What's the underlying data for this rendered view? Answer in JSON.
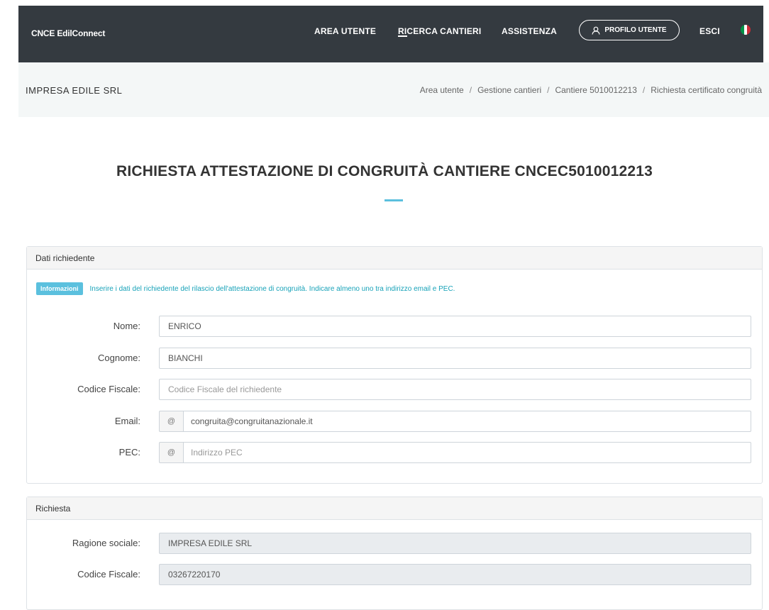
{
  "header": {
    "brand": "CNCE EdilConnect",
    "nav": [
      {
        "label": "AREA UTENTE",
        "active": false
      },
      {
        "label": "RICERCA CANTIERI",
        "active": true
      },
      {
        "label": "ASSISTENZA",
        "active": false
      }
    ],
    "profile_label": "PROFILO UTENTE",
    "logout_label": "ESCI",
    "flag_colors": [
      "#009246",
      "#ffffff",
      "#ce2b37"
    ]
  },
  "subheader": {
    "company": "IMPRESA EDILE SRL",
    "breadcrumb": [
      "Area utente",
      "Gestione cantieri",
      "Cantiere 5010012213",
      "Richiesta certificato congruità"
    ]
  },
  "page": {
    "title": "RICHIESTA ATTESTAZIONE DI CONGRUITÀ CANTIERE CNCEC5010012213"
  },
  "requester_panel": {
    "heading": "Dati richiedente",
    "info_badge": "Informazioni",
    "info_text": "Inserire i dati del richiedente del rilascio dell'attestazione di congruità. Indicare almeno uno tra indirizzo email e PEC.",
    "fields": {
      "nome": {
        "label": "Nome:",
        "value": "ENRICO",
        "placeholder": ""
      },
      "cognome": {
        "label": "Cognome:",
        "value": "BIANCHI",
        "placeholder": ""
      },
      "codice_fiscale": {
        "label": "Codice Fiscale:",
        "value": "",
        "placeholder": "Codice Fiscale del richiedente"
      },
      "email": {
        "label": "Email:",
        "addon": "@",
        "value": "congruita@congruitanazionale.it",
        "placeholder": ""
      },
      "pec": {
        "label": "PEC:",
        "addon": "@",
        "value": "",
        "placeholder": "Indirizzo PEC"
      }
    }
  },
  "request_panel": {
    "heading": "Richiesta",
    "fields": {
      "ragione_sociale": {
        "label": "Ragione sociale:",
        "value": "IMPRESA EDILE SRL"
      },
      "codice_fiscale": {
        "label": "Codice Fiscale:",
        "value": "03267220170"
      }
    }
  },
  "colors": {
    "topbar": "#343a40",
    "accent": "#5bc0de",
    "info_text": "#17a2b8"
  }
}
